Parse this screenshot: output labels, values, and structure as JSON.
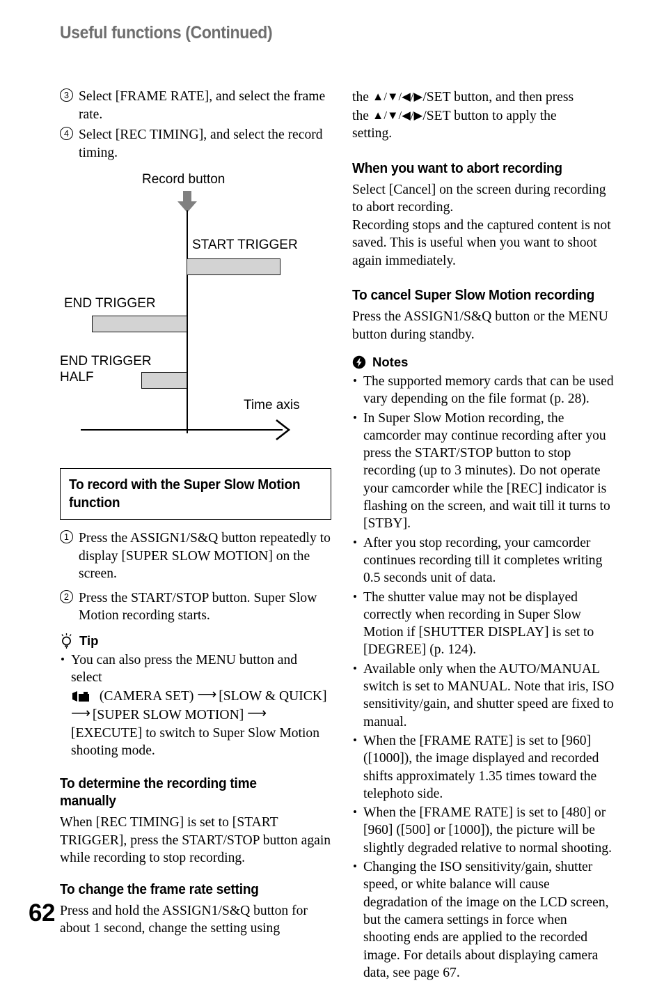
{
  "document": {
    "header_title": "Useful functions (Continued)",
    "page_number": "62"
  },
  "left_column": {
    "steps": [
      {
        "num": "3",
        "text": "Select [FRAME RATE], and select the frame rate."
      },
      {
        "num": "4",
        "text": "Select [REC TIMING], and select the record timing."
      }
    ],
    "diagram": {
      "record_button_label": "Record button",
      "time_axis_label": "Time axis",
      "bars": [
        {
          "label": "START TRIGGER",
          "fill": "#d3d3d3"
        },
        {
          "label": "END TRIGGER",
          "fill": "#d3d3d3"
        },
        {
          "label": "END TRIGGER\nHALF",
          "fill": "#d3d3d3"
        }
      ]
    },
    "section_record": {
      "heading": "To record with the Super Slow Motion function",
      "steps": [
        {
          "num": "1",
          "text": "Press the ASSIGN1/S&Q button repeatedly to display [SUPER SLOW MOTION] on the screen."
        },
        {
          "num": "2",
          "text": "Press the START/STOP button. Super Slow Motion recording starts."
        }
      ]
    },
    "tip": {
      "title": "Tip",
      "icon": "lightbulb-icon",
      "text_part1": "You can also press the MENU button and select",
      "camera_icon": "camcorder-icon",
      "text_part2": "(CAMERA SET)",
      "text_part3": "[SLOW & QUICK]",
      "text_part4": "[SUPER SLOW MOTION]",
      "text_part5": "[EXECUTE] to switch to Super Slow Motion shooting mode."
    },
    "section_recording_time": {
      "heading": "To determine the recording time manually",
      "body": "When [REC TIMING] is set to [START TRIGGER], press the START/STOP button again while recording to stop recording."
    },
    "section_frame_rate": {
      "heading": "To change the frame rate setting",
      "body": "Press and hold the ASSIGN1/S&Q button for about 1 second, change the setting using"
    }
  },
  "right_column": {
    "continued_text": {
      "line1_pre": "the ",
      "line1_post": "/SET button, and then press",
      "line2_pre": "the ",
      "line2_post": "/SET button to apply the",
      "line3": "setting."
    },
    "section_abort": {
      "heading": "When you want to abort recording",
      "body": "Select [Cancel] on the screen during recording to abort recording.\nRecording stops and the captured content is not saved. This is useful when you want to shoot again immediately."
    },
    "section_cancel": {
      "heading": "To cancel Super Slow Motion recording",
      "body": "Press the ASSIGN1/S&Q button or the MENU button during standby."
    },
    "notes": {
      "title": "Notes",
      "icon": "notes-flash-icon",
      "items": [
        "The supported memory cards that can be used vary depending on the file format (p. 28).",
        "In Super Slow Motion recording, the camcorder may continue recording after you press the START/STOP button to stop recording (up to 3 minutes). Do not operate your camcorder while the [REC] indicator is flashing on the screen, and wait till it turns to [STBY].",
        "After you stop recording, your camcorder continues recording till it completes writing 0.5 seconds unit of data.",
        "The shutter value may not be displayed correctly when recording in Super Slow Motion if [SHUTTER DISPLAY] is set to [DEGREE] (p. 124).",
        "Available only when the AUTO/MANUAL switch is set to MANUAL. Note that iris, ISO sensitivity/gain, and shutter speed are fixed to manual.",
        "When the [FRAME RATE] is set to [960] ([1000]), the image displayed and recorded shifts approximately 1.35 times toward the telephoto side.",
        "When the [FRAME RATE] is set to [480] or [960] ([500] or [1000]), the picture will be slightly degraded relative to normal shooting.",
        "Changing the ISO sensitivity/gain, shutter speed, or white balance will cause degradation of the image on the LCD screen, but the camera settings in force when shooting ends are applied to the recorded image. For details about displaying camera data, see page 67."
      ]
    }
  },
  "colors": {
    "header_gray": "#6e6e6e",
    "bar_fill": "#d3d3d3",
    "arrow_gray": "#808080",
    "text_black": "#000000"
  }
}
